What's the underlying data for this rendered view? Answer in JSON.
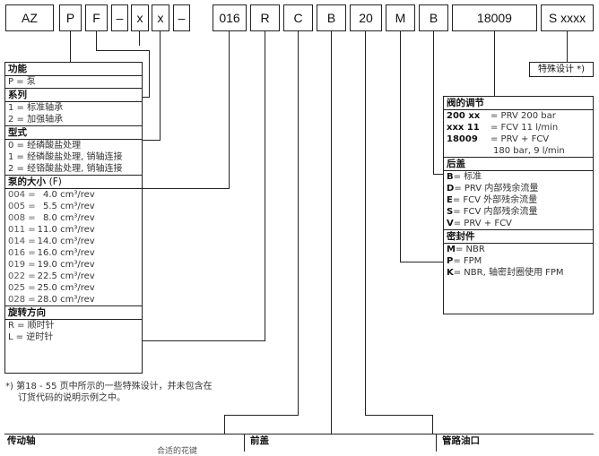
{
  "code_boxes": [
    {
      "label": "AZ"
    },
    {
      "label": "P"
    },
    {
      "label": "F"
    },
    {
      "label": "–"
    },
    {
      "label": "x"
    },
    {
      "label": "x"
    },
    {
      "label": "–"
    },
    {
      "label": "016"
    },
    {
      "label": "R"
    },
    {
      "label": "C"
    },
    {
      "label": "B"
    },
    {
      "label": "20"
    },
    {
      "label": "M"
    },
    {
      "label": "B"
    },
    {
      "label": "18009"
    },
    {
      "label": "S xxxx"
    }
  ],
  "left_panel": {
    "function": {
      "title": "功能",
      "rows": [
        "P = 泵"
      ]
    },
    "series": {
      "title": "系列",
      "rows": [
        "1 = 标准轴承",
        "2 = 加强轴承"
      ]
    },
    "type": {
      "title": "型式",
      "rows": [
        "0 = 经磷酸盐处理",
        "1 = 经磷酸盐处理, 销轴连接",
        "2 = 经铬酸盐处理, 销轴连接"
      ]
    },
    "size": {
      "title": "泵的大小",
      "unit": "(F)",
      "rows": [
        {
          "code": "004 =",
          "val": "  4.0 cm³/rev"
        },
        {
          "code": "005 =",
          "val": "  5.5 cm³/rev"
        },
        {
          "code": "008 =",
          "val": "  8.0 cm³/rev"
        },
        {
          "code": "011 =",
          "val": "11.0 cm³/rev"
        },
        {
          "code": "014 =",
          "val": "14.0 cm³/rev"
        },
        {
          "code": "016 =",
          "val": "16.0 cm³/rev"
        },
        {
          "code": "019 =",
          "val": "19.0 cm³/rev"
        },
        {
          "code": "022 =",
          "val": "22.5 cm³/rev"
        },
        {
          "code": "025 =",
          "val": "25.0 cm³/rev"
        },
        {
          "code": "028 =",
          "val": "28.0 cm³/rev"
        }
      ]
    },
    "rotation": {
      "title": "旋转方向",
      "rows": [
        "R = 顺时针",
        "L = 逆时针"
      ]
    }
  },
  "footnote": {
    "line1": "*) 第18 - 55 页中所示的一些特殊设计，并未包含在",
    "line2": "订货代码的说明示例之中。"
  },
  "special": {
    "label": "特殊设计 *)"
  },
  "right_panel": {
    "valve": {
      "title": "阀的调节",
      "rows": [
        {
          "code": "200 xx",
          "val": "= PRV 200 bar"
        },
        {
          "code": "xxx 11",
          "val": "= FCV 11 l/min"
        },
        {
          "code": "18009",
          "val": "= PRV + FCV"
        },
        {
          "code": "",
          "val": "180 bar, 9 l/min"
        }
      ]
    },
    "rear_cover": {
      "title": "后盖",
      "rows": [
        {
          "code": "B",
          "val": "= 标准"
        },
        {
          "code": "D",
          "val": "= PRV 内部残余流量"
        },
        {
          "code": "E",
          "val": "= FCV 外部残余流量"
        },
        {
          "code": "S",
          "val": "= FCV 内部残余流量"
        },
        {
          "code": "V",
          "val": "= PRV + FCV"
        }
      ]
    },
    "seal": {
      "title": "密封件",
      "rows": [
        {
          "code": "M",
          "val": "= NBR"
        },
        {
          "code": "P",
          "val": "= FPM"
        },
        {
          "code": "K",
          "val": "= NBR, 轴密封圈使用 FPM"
        }
      ]
    }
  },
  "bottom": {
    "drive_shaft": "传动轴",
    "front_cover": "前盖",
    "pipe_port": "管路油口",
    "partial_text": "合适的花键"
  }
}
